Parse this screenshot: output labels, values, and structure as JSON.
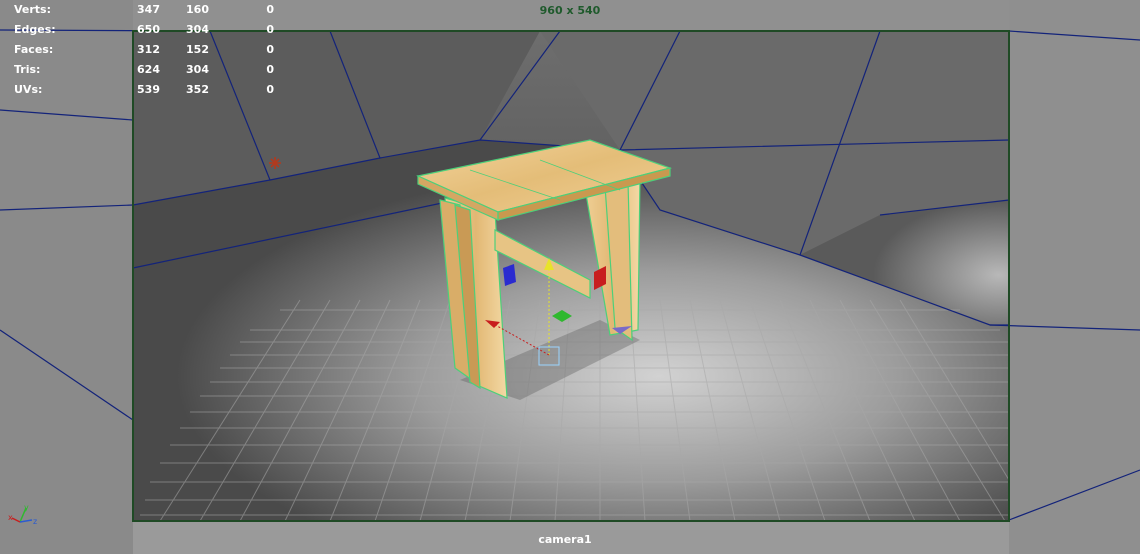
{
  "viewport": {
    "resolution_label": "960 x 540",
    "camera_label": "camera1",
    "colors": {
      "background": "#8a8a8a",
      "resolution_gate": "#1f4a25",
      "wall_edges": "#13237a",
      "grid_lines": "#9c9c9c",
      "wood": "#e8c58a",
      "selection_wire": "#4cd07a"
    }
  },
  "hud": {
    "rows": [
      {
        "label": "Verts:",
        "v1": "347",
        "v2": "160",
        "v3": "0"
      },
      {
        "label": "Edges:",
        "v1": "650",
        "v2": "304",
        "v3": "0"
      },
      {
        "label": "Faces:",
        "v1": "312",
        "v2": "152",
        "v3": "0"
      },
      {
        "label": "Tris:",
        "v1": "624",
        "v2": "304",
        "v3": "0"
      },
      {
        "label": "UVs:",
        "v1": "539",
        "v2": "352",
        "v3": "0"
      }
    ]
  },
  "axis": {
    "x": "x",
    "y": "y",
    "z": "z"
  }
}
